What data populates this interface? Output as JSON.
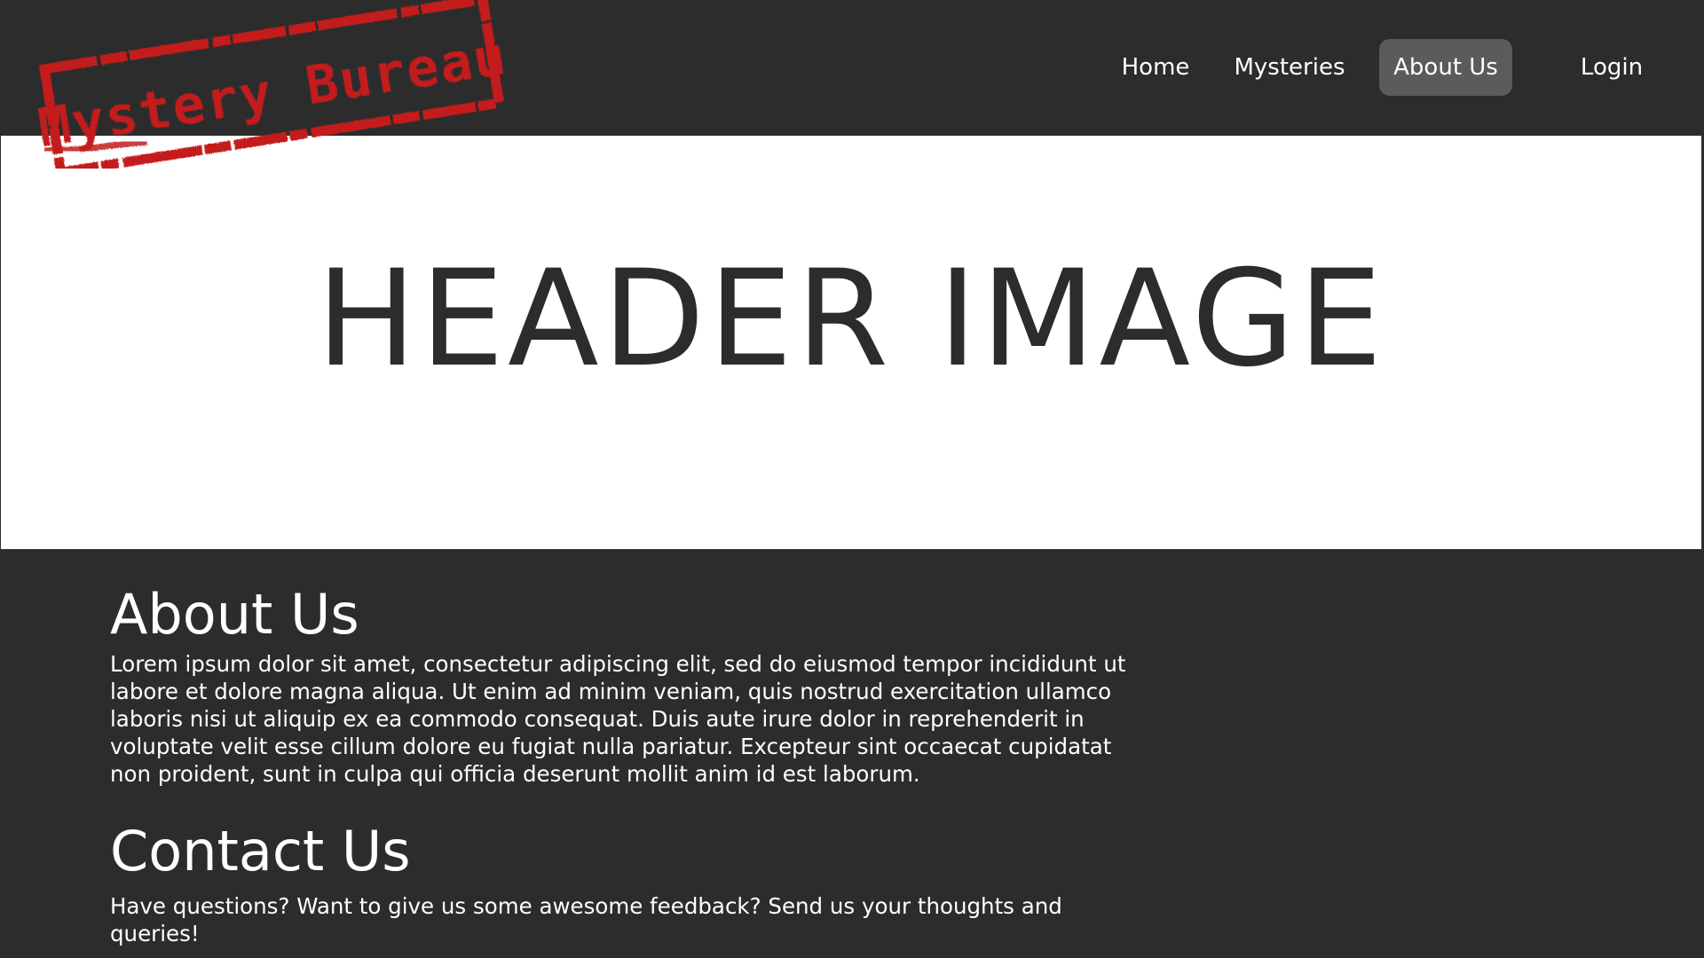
{
  "logo": {
    "text": "Mystery Bureau",
    "color": "#c41e1e"
  },
  "nav": {
    "items": [
      {
        "label": "Home",
        "active": false
      },
      {
        "label": "Mysteries",
        "active": false
      },
      {
        "label": "About Us",
        "active": true
      },
      {
        "label": "Login",
        "active": false
      }
    ]
  },
  "hero": {
    "text": "HEADER IMAGE"
  },
  "about": {
    "title": "About Us",
    "body": "Lorem ipsum dolor sit amet, consectetur adipiscing elit, sed do eiusmod tempor incididunt ut labore et dolore magna aliqua. Ut enim ad minim veniam, quis nostrud exercitation ullamco laboris nisi ut aliquip ex ea commodo consequat. Duis aute irure dolor in reprehenderit in voluptate velit esse cillum dolore eu fugiat nulla pariatur. Excepteur sint occaecat cupidatat non proident, sunt in culpa qui officia deserunt mollit anim id est laborum."
  },
  "contact": {
    "title": "Contact Us",
    "body": "Have questions? Want to give us some awesome feedback? Send us your thoughts and queries!"
  },
  "colors": {
    "background": "#2c2c2c",
    "nav_active": "#5b5b5b",
    "hero_bg": "#ffffff",
    "stamp_red": "#c41e1e"
  }
}
